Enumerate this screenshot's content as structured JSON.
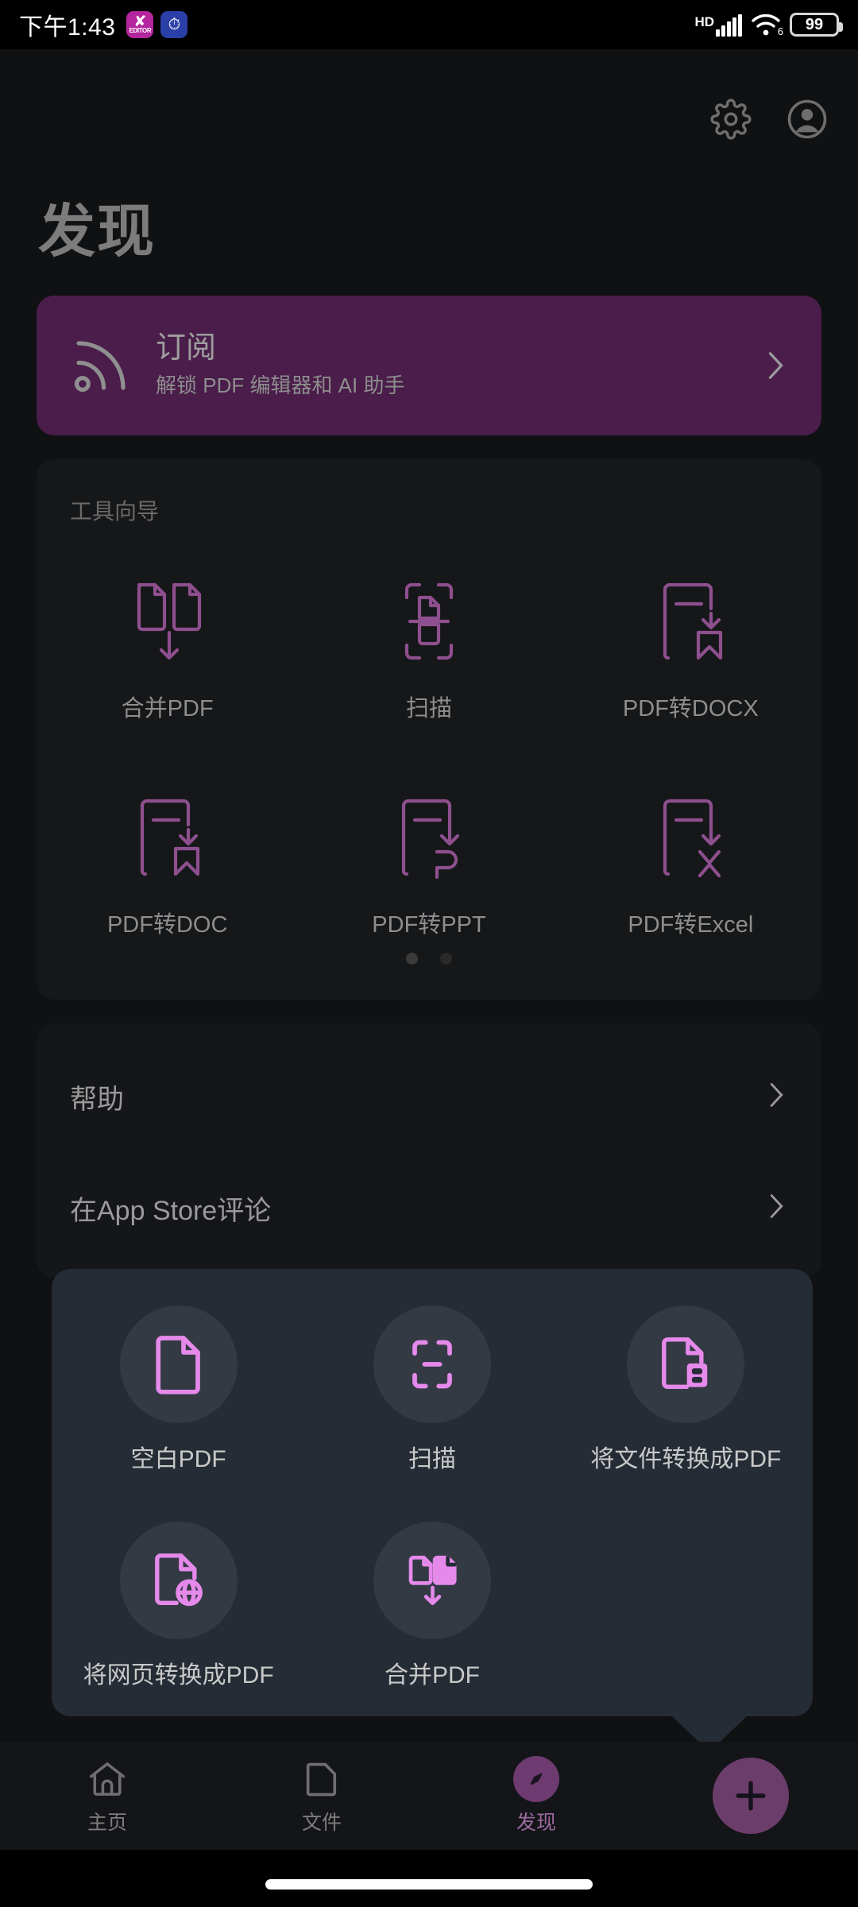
{
  "status_bar": {
    "time": "下午1:43",
    "notification_icons": [
      {
        "name": "editor-app-icon",
        "glyph": "✘",
        "label": "EDITOR",
        "color": "#b5259e"
      },
      {
        "name": "timer-app-icon",
        "glyph": "⏱",
        "color": "#2b3fa8"
      }
    ],
    "network_type": "HD",
    "wifi_generation": "6",
    "battery_level": "99"
  },
  "header": {
    "title": "发现",
    "settings_icon": "gear-icon",
    "account_icon": "account-avatar-icon"
  },
  "subscribe_banner": {
    "icon": "rss-signal-icon",
    "title": "订阅",
    "subtitle": "解锁 PDF 编辑器和 AI 助手",
    "chevron": "chevron-right-icon",
    "background_color": "#4a1d4a"
  },
  "tools_card": {
    "section_title": "工具向导",
    "accent_color": "#8e4f8e",
    "items": [
      {
        "label": "合并PDF",
        "icon": "merge-pdf-icon"
      },
      {
        "label": "扫描",
        "icon": "scan-icon"
      },
      {
        "label": "PDF转DOCX",
        "icon": "pdf-to-docx-icon"
      },
      {
        "label": "PDF转DOC",
        "icon": "pdf-to-doc-icon"
      },
      {
        "label": "PDF转PPT",
        "icon": "pdf-to-ppt-icon"
      },
      {
        "label": "PDF转Excel",
        "icon": "pdf-to-excel-icon"
      }
    ],
    "page_dots": {
      "count": 2,
      "active_index": 0
    }
  },
  "menu_list": {
    "rows": [
      {
        "label": "帮助",
        "chevron": "chevron-right-icon"
      },
      {
        "label": "在App Store评论",
        "chevron": "chevron-right-icon"
      }
    ]
  },
  "create_popup": {
    "accent_color": "#e589ea",
    "background_color": "#252c35",
    "items": [
      {
        "label": "空白PDF",
        "icon": "blank-pdf-icon"
      },
      {
        "label": "扫描",
        "icon": "scan-frame-icon"
      },
      {
        "label": "将文件转换成PDF",
        "icon": "file-to-pdf-icon"
      },
      {
        "label": "将网页转换成PDF",
        "icon": "webpage-to-pdf-icon"
      },
      {
        "label": "合并PDF",
        "icon": "merge-pdf-icon"
      }
    ]
  },
  "bottom_nav": {
    "items": [
      {
        "label": "主页",
        "icon": "home-icon",
        "active": false
      },
      {
        "label": "文件",
        "icon": "folder-icon",
        "active": false
      },
      {
        "label": "发现",
        "icon": "compass-icon",
        "active": true
      }
    ],
    "fab": {
      "icon": "plus-icon",
      "color": "#6b3d6b"
    }
  }
}
